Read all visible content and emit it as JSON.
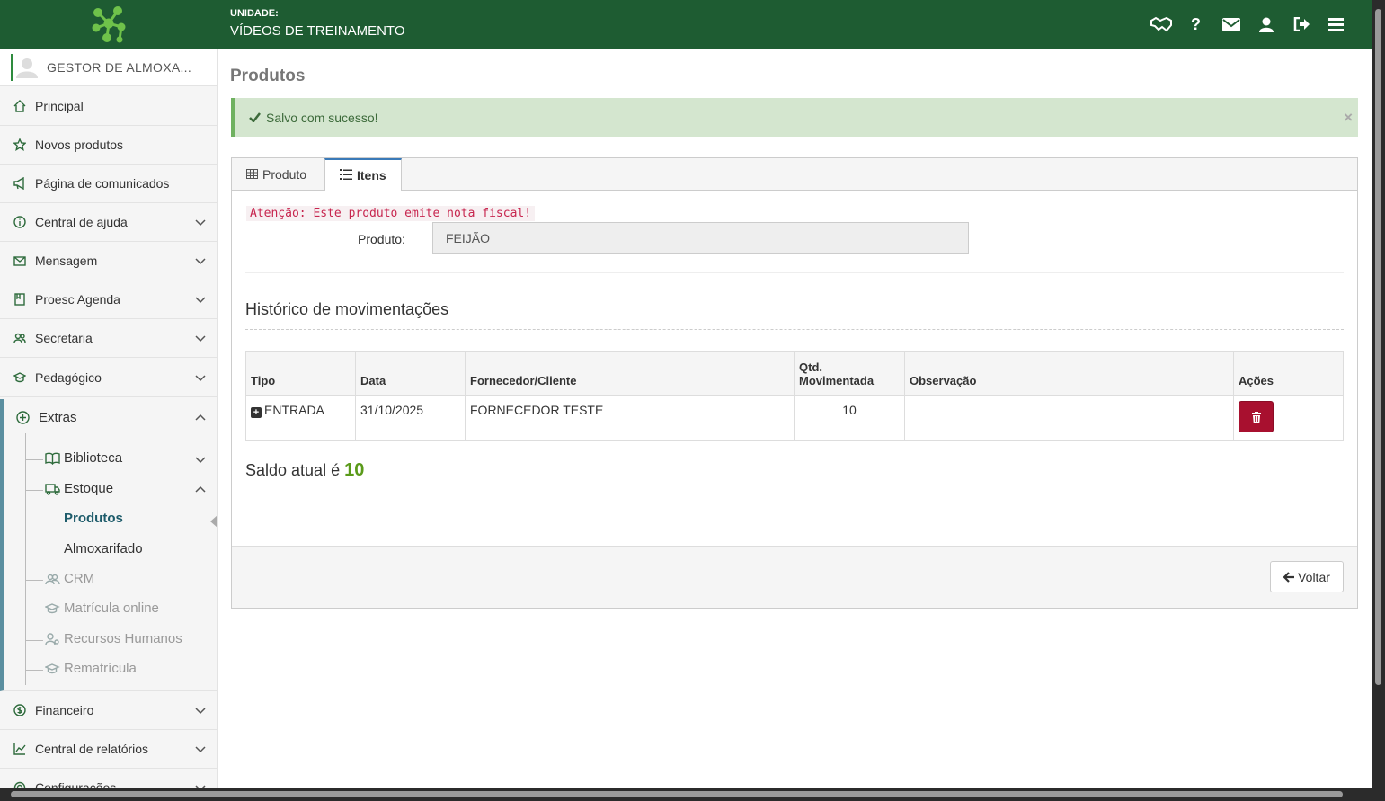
{
  "header": {
    "unit_label": "UNIDADE:",
    "unit_name": "VÍDEOS DE TREINAMENTO",
    "icons": [
      "handshake-icon",
      "help-icon",
      "envelope-icon",
      "user-icon",
      "logout-icon",
      "menu-icon"
    ],
    "help_glyph": "?"
  },
  "user": {
    "name": "GESTOR DE ALMOXA..."
  },
  "sidebar": {
    "items": [
      {
        "label": "Principal"
      },
      {
        "label": "Novos produtos"
      },
      {
        "label": "Página de comunicados"
      },
      {
        "label": "Central de ajuda"
      },
      {
        "label": "Mensagem"
      },
      {
        "label": "Proesc Agenda"
      },
      {
        "label": "Secretaria"
      },
      {
        "label": "Pedagógico"
      },
      {
        "label": "Extras"
      },
      {
        "label": "Financeiro"
      },
      {
        "label": "Central de relatórios"
      },
      {
        "label": "Configurações"
      }
    ],
    "extras_sub": {
      "biblioteca": "Biblioteca",
      "estoque": "Estoque",
      "produtos": "Produtos",
      "almoxarifado": "Almoxarifado",
      "crm": "CRM",
      "matricula": "Matrícula online",
      "rh": "Recursos Humanos",
      "rematricula": "Rematrícula"
    }
  },
  "page": {
    "title": "Produtos",
    "alert": "Salvo com sucesso!",
    "alert_close": "×",
    "tabs": [
      {
        "label": "Produto"
      },
      {
        "label": "Itens"
      }
    ],
    "warning": "Atenção: Este produto emite nota fiscal!",
    "produto_label": "Produto:",
    "produto_value": "FEIJÃO",
    "history_title": "Histórico de movimentações",
    "table": {
      "headers": [
        "Tipo",
        "Data",
        "Fornecedor/Cliente",
        "Qtd. Movimentada",
        "Observação",
        "Ações"
      ],
      "rows": [
        {
          "tipo": "ENTRADA",
          "data": "31/10/2025",
          "fornecedor": "FORNECEDOR TESTE",
          "qtd": "10",
          "obs": ""
        }
      ]
    },
    "saldo_label": "Saldo atual é",
    "saldo_value": "10",
    "voltar": "Voltar"
  },
  "colors": {
    "topbar": "#1e5c32",
    "alert_bg": "#d4e6cf",
    "danger": "#a8102f",
    "saldo": "#5a9a1a",
    "active_link": "#1e5c6b"
  }
}
